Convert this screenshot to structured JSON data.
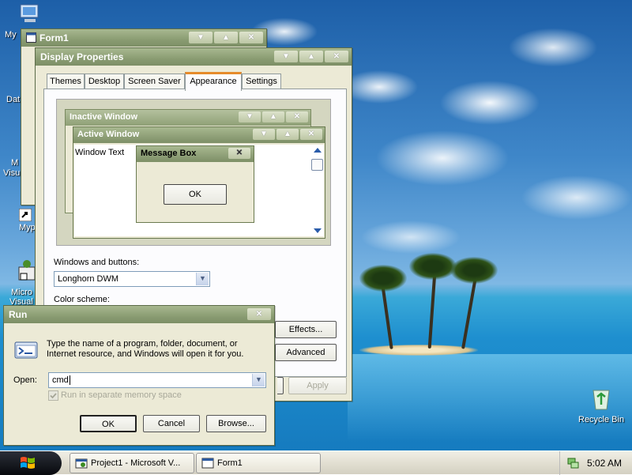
{
  "desktop": {
    "icons": [
      {
        "label": "My"
      },
      {
        "label": "Dat"
      },
      {
        "label": "M"
      },
      {
        "label": "Visu"
      },
      {
        "label": "Myp"
      },
      {
        "label": "Micro"
      },
      {
        "label": "Visual"
      }
    ],
    "recycle_bin": "Recycle Bin"
  },
  "form1": {
    "title": "Form1"
  },
  "display_properties": {
    "title": "Display Properties",
    "tabs": [
      {
        "label": "Themes"
      },
      {
        "label": "Desktop"
      },
      {
        "label": "Screen Saver"
      },
      {
        "label": "Appearance",
        "active": true
      },
      {
        "label": "Settings"
      }
    ],
    "preview": {
      "inactive_title": "Inactive Window",
      "active_title": "Active Window",
      "window_text": "Window Text",
      "message_box_title": "Message Box",
      "ok_label": "OK"
    },
    "windows_buttons_label": "Windows and buttons:",
    "windows_buttons_value": "Longhorn DWM",
    "color_scheme_label": "Color scheme:",
    "effects_label": "Effects...",
    "advanced_label": "Advanced",
    "apply_label": "Apply"
  },
  "run": {
    "title": "Run",
    "description": "Type the name of a program, folder, document, or Internet resource, and Windows will open it for you.",
    "open_label": "Open:",
    "open_value": "cmd",
    "separate_memory_label": "Run in separate memory space",
    "ok_label": "OK",
    "cancel_label": "Cancel",
    "browse_label": "Browse..."
  },
  "taskbar": {
    "items": [
      {
        "label": "Project1 - Microsoft V..."
      },
      {
        "label": "Form1"
      }
    ],
    "clock": "5:02 AM"
  },
  "titlebar_glyphs": {
    "minimize": "▼",
    "maximize": "▲",
    "close": "✕"
  },
  "colors": {
    "window_frame": "#8a9c72",
    "window_body": "#ecead6",
    "accent_blue": "#316ac5"
  }
}
